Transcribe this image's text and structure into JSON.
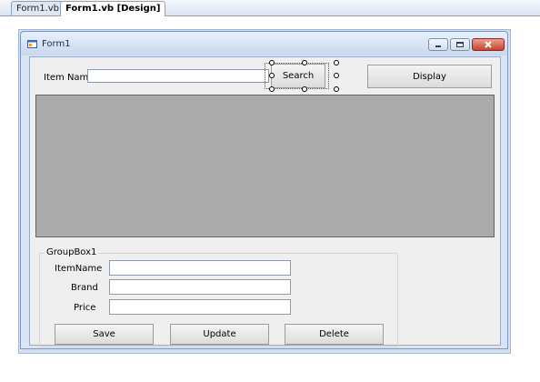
{
  "tabs": [
    {
      "label": "Form1.vb"
    },
    {
      "label": "Form1.vb [Design]"
    }
  ],
  "form": {
    "title": "Form1",
    "icon": "form-icon",
    "caption_buttons": [
      "minimize-icon",
      "maximize-icon",
      "close-icon"
    ]
  },
  "search_row": {
    "item_name_label": "Item Name",
    "item_name_value": "",
    "search_label": "Search",
    "display_label": "Display"
  },
  "groupbox": {
    "caption": "GroupBox1",
    "fields": [
      {
        "label": "ItemName",
        "value": ""
      },
      {
        "label": "Brand",
        "value": ""
      },
      {
        "label": "Price",
        "value": ""
      }
    ],
    "buttons": {
      "save": "Save",
      "update": "Update",
      "delete": "Delete"
    }
  },
  "colors": {
    "grid_background": "#ababab",
    "form_background": "#efefef",
    "close_button": "#c6442f"
  }
}
